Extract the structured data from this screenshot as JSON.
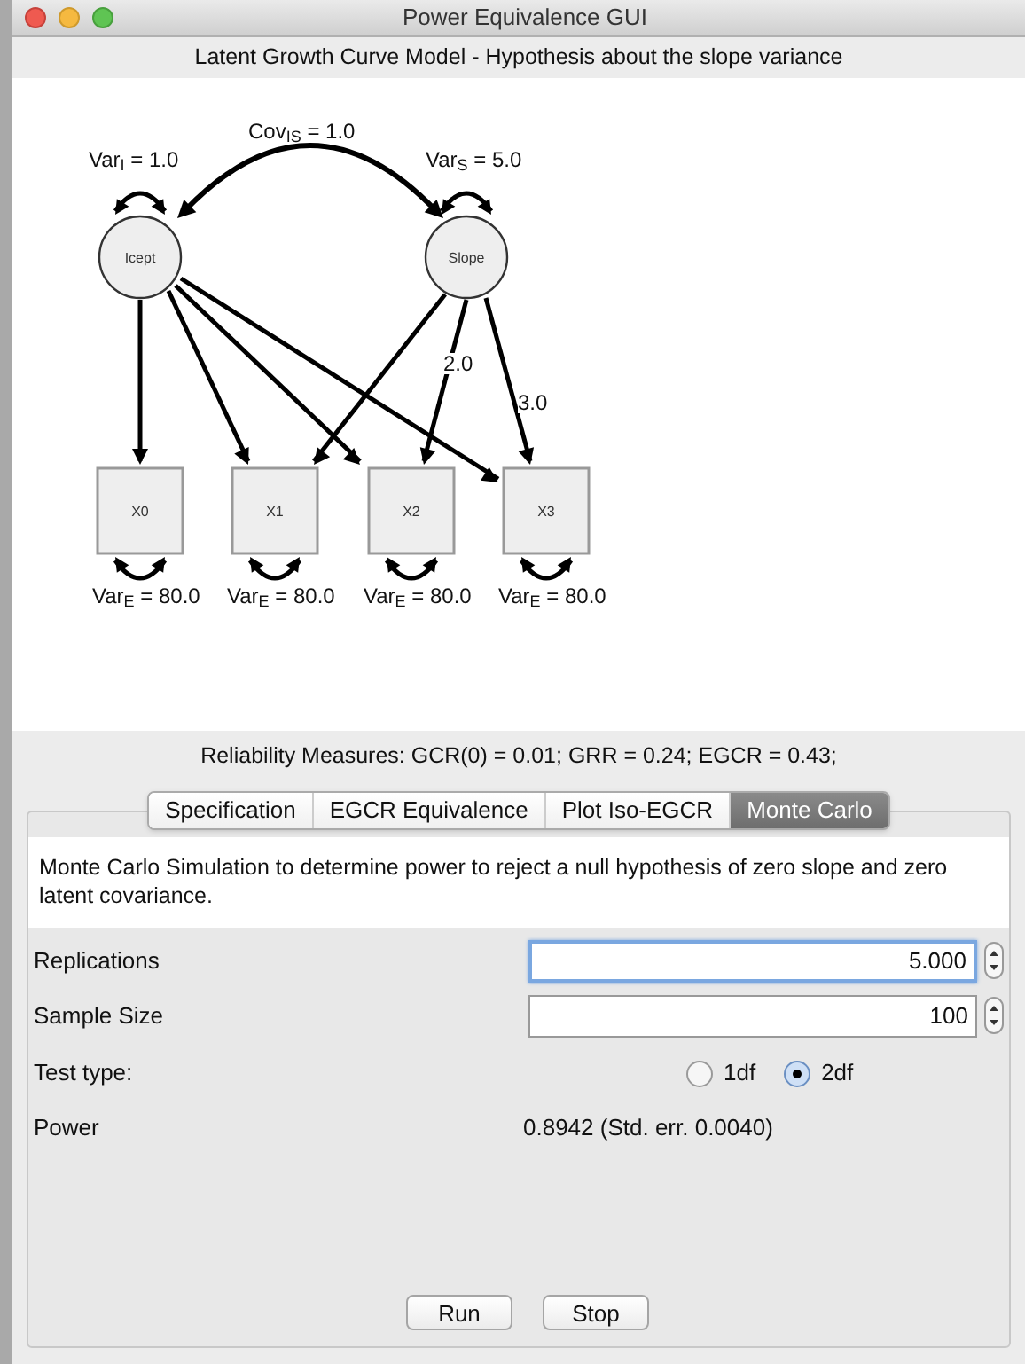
{
  "window": {
    "title": "Power Equivalence GUI"
  },
  "header": "Latent Growth Curve Model - Hypothesis about the slope variance",
  "diagram": {
    "covariance_label": "Cov$_{IS}$ = 1.0",
    "latent": [
      {
        "label": "Icept",
        "variance": "Var$_{I}$ = 1.0"
      },
      {
        "label": "Slope",
        "variance": "Var$_{S}$ = 5.0"
      }
    ],
    "observed": [
      {
        "label": "X0",
        "variance": "Var$_{E}$ = 80.0"
      },
      {
        "label": "X1",
        "variance": "Var$_{E}$ = 80.0"
      },
      {
        "label": "X2",
        "variance": "Var$_{E}$ = 80.0"
      },
      {
        "label": "X3",
        "variance": "Var$_{E}$ = 80.0"
      }
    ],
    "slope_loadings": [
      "2.0",
      "3.0"
    ]
  },
  "reliability": "Reliability Measures: GCR(0) = 0.01; GRR = 0.24; EGCR = 0.43;",
  "tabs": [
    {
      "label": "Specification",
      "selected": false
    },
    {
      "label": "EGCR Equivalence",
      "selected": false
    },
    {
      "label": "Plot Iso-EGCR",
      "selected": false
    },
    {
      "label": "Monte Carlo",
      "selected": true
    }
  ],
  "description": "Monte Carlo Simulation to determine power to reject a null hypothesis of zero slope and zero latent covariance.",
  "rows": [
    {
      "kind": "spinner",
      "label": "Replications",
      "value": "5.000",
      "focused": true
    },
    {
      "kind": "spinner",
      "label": "Sample Size",
      "value": "100",
      "focused": false
    },
    {
      "kind": "radio",
      "label": "Test type:",
      "options": [
        {
          "label": "1df",
          "selected": false
        },
        {
          "label": "2df",
          "selected": true
        }
      ]
    },
    {
      "kind": "readout",
      "label": "Power",
      "value": "0.8942 (Std. err. 0.0040)"
    }
  ],
  "buttons": [
    "Run",
    "Stop"
  ]
}
